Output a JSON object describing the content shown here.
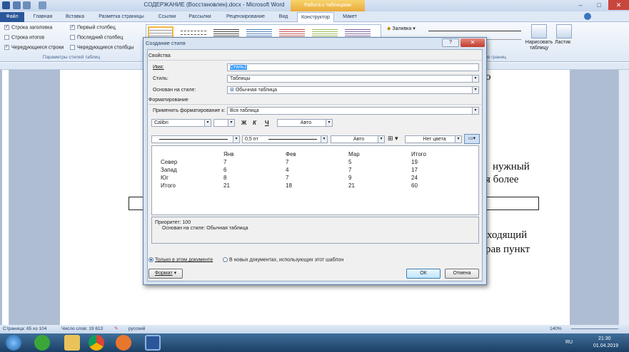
{
  "window": {
    "title": "СОДЕРЖАНИЕ (Восстановлен).docx - Microsoft Word",
    "context_tab": "Работа с таблицами"
  },
  "tabs": [
    "Файл",
    "Главная",
    "Вставка",
    "Разметка страницы",
    "Ссылки",
    "Рассылки",
    "Рецензирование",
    "Вид",
    "Конструктор",
    "Макет"
  ],
  "ribbon": {
    "options": [
      "Строка заголовка",
      "Строка итогов",
      "Чередующиеся строки",
      "Первый столбец",
      "Последний столбец",
      "Чередующиеся столбцы"
    ],
    "options_checked": [
      true,
      false,
      true,
      true,
      false,
      false
    ],
    "group_label": "Параметры стилей таблиц",
    "fill_label": "Заливка",
    "draw_table": "Нарисовать таблицу",
    "eraser": "Ластик",
    "borders_group": "ание границ"
  },
  "document": {
    "text1": "нужный",
    "text2": "ия более",
    "text3": "ходящий",
    "text4": "рав пункт",
    "text_top": "о"
  },
  "dialog": {
    "title": "Создание стиля",
    "help": "?",
    "section_props": "Свойства",
    "name_label": "Имя:",
    "name_value": "Стиль1",
    "style_label": "Стиль:",
    "style_value": "Таблицы",
    "based_label": "Основан на стиле:",
    "based_value": "Обычная таблица",
    "section_format": "Форматирование",
    "apply_label": "Применить форматирование к:",
    "apply_value": "Вся таблица",
    "font": "Calibri",
    "bold": "Ж",
    "italic": "К",
    "underline": "Ч",
    "color": "Авто",
    "border_width": "0,5 пт",
    "border_color": "Авто",
    "shade": "Нет цвета",
    "preview": {
      "headers": [
        "",
        "Янв",
        "Фев",
        "Мар",
        "Итого"
      ],
      "rows": [
        [
          "Север",
          "7",
          "7",
          "5",
          "19"
        ],
        [
          "Запад",
          "6",
          "4",
          "7",
          "17"
        ],
        [
          "Юг",
          "8",
          "7",
          "9",
          "24"
        ],
        [
          "Итого",
          "21",
          "18",
          "21",
          "60"
        ]
      ]
    },
    "priority": "Приоритет: 100",
    "based_desc": "Основан на стиле: Обычная таблица",
    "radio1": "Только в этом документе",
    "radio2": "В новых документах, использующих этот шаблон",
    "format_btn": "Формат",
    "ok": "ОК",
    "cancel": "Отмена"
  },
  "status": {
    "page": "Страница: 65 из 104",
    "words": "Число слов: 19 613",
    "lang": "русский",
    "zoom": "140%"
  },
  "taskbar": {
    "lang": "RU",
    "time": "21:30",
    "date": "01.04.2019"
  }
}
